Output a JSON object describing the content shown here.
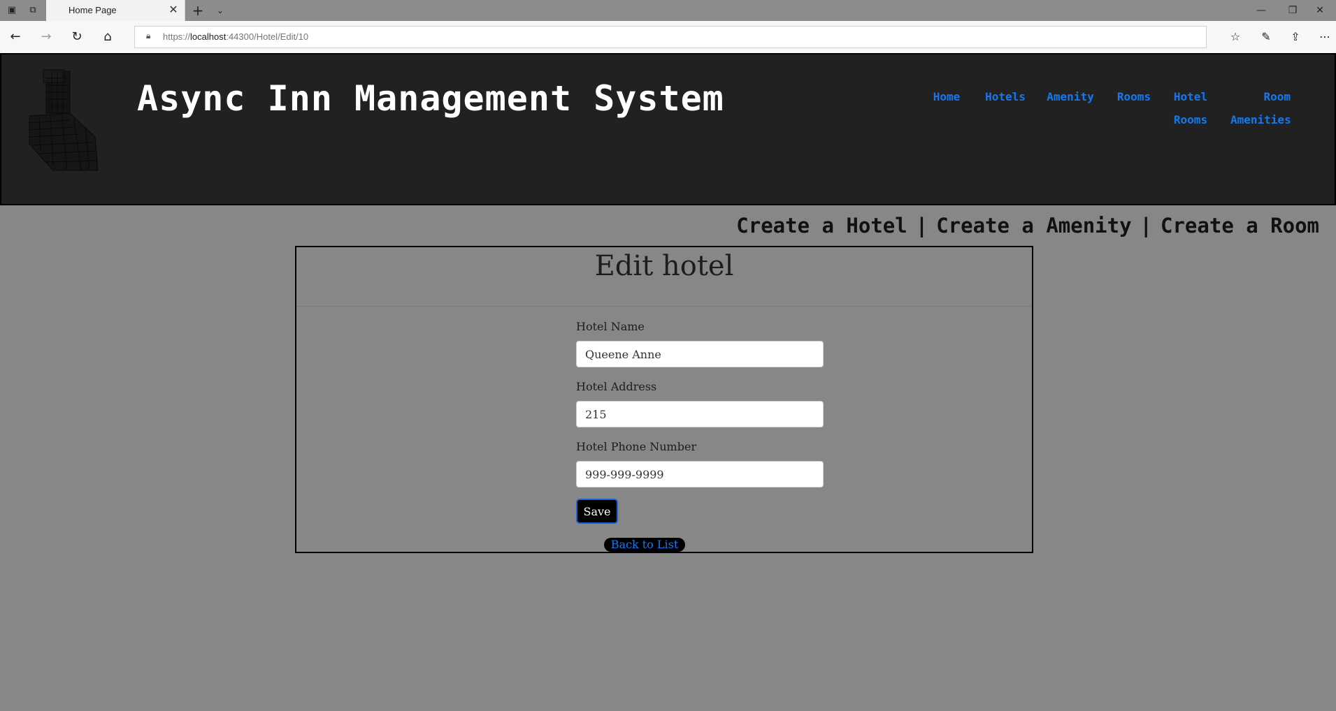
{
  "browser": {
    "tab_title": "Home Page",
    "url_prefix": "https://",
    "url_host": "localhost",
    "url_rest": ":44300/Hotel/Edit/10"
  },
  "site": {
    "title": "Async Inn Management System",
    "nav": {
      "home": "Home",
      "hotels": "Hotels",
      "amenity": "Amenity",
      "rooms": "Rooms",
      "hotel_rooms_line1": "Hotel",
      "hotel_rooms_line2": "Rooms",
      "room_amenities_line1": "Room",
      "room_amenities_line2": "Amenities"
    }
  },
  "subnav": {
    "create_hotel": "Create a Hotel",
    "create_amenity": "Create a Amenity",
    "create_room": "Create a Room",
    "separator": "|"
  },
  "form": {
    "title": "Edit hotel",
    "name_label": "Hotel Name",
    "name_value": "Queene Anne",
    "address_label": "Hotel Address",
    "address_value": "215",
    "phone_label": "Hotel Phone Number",
    "phone_value": "999-999-9999",
    "save_label": "Save",
    "back_label": "Back to List"
  },
  "colors": {
    "page_bg": "#878787",
    "header_bg": "#212121",
    "nav_link": "#1478f0"
  }
}
